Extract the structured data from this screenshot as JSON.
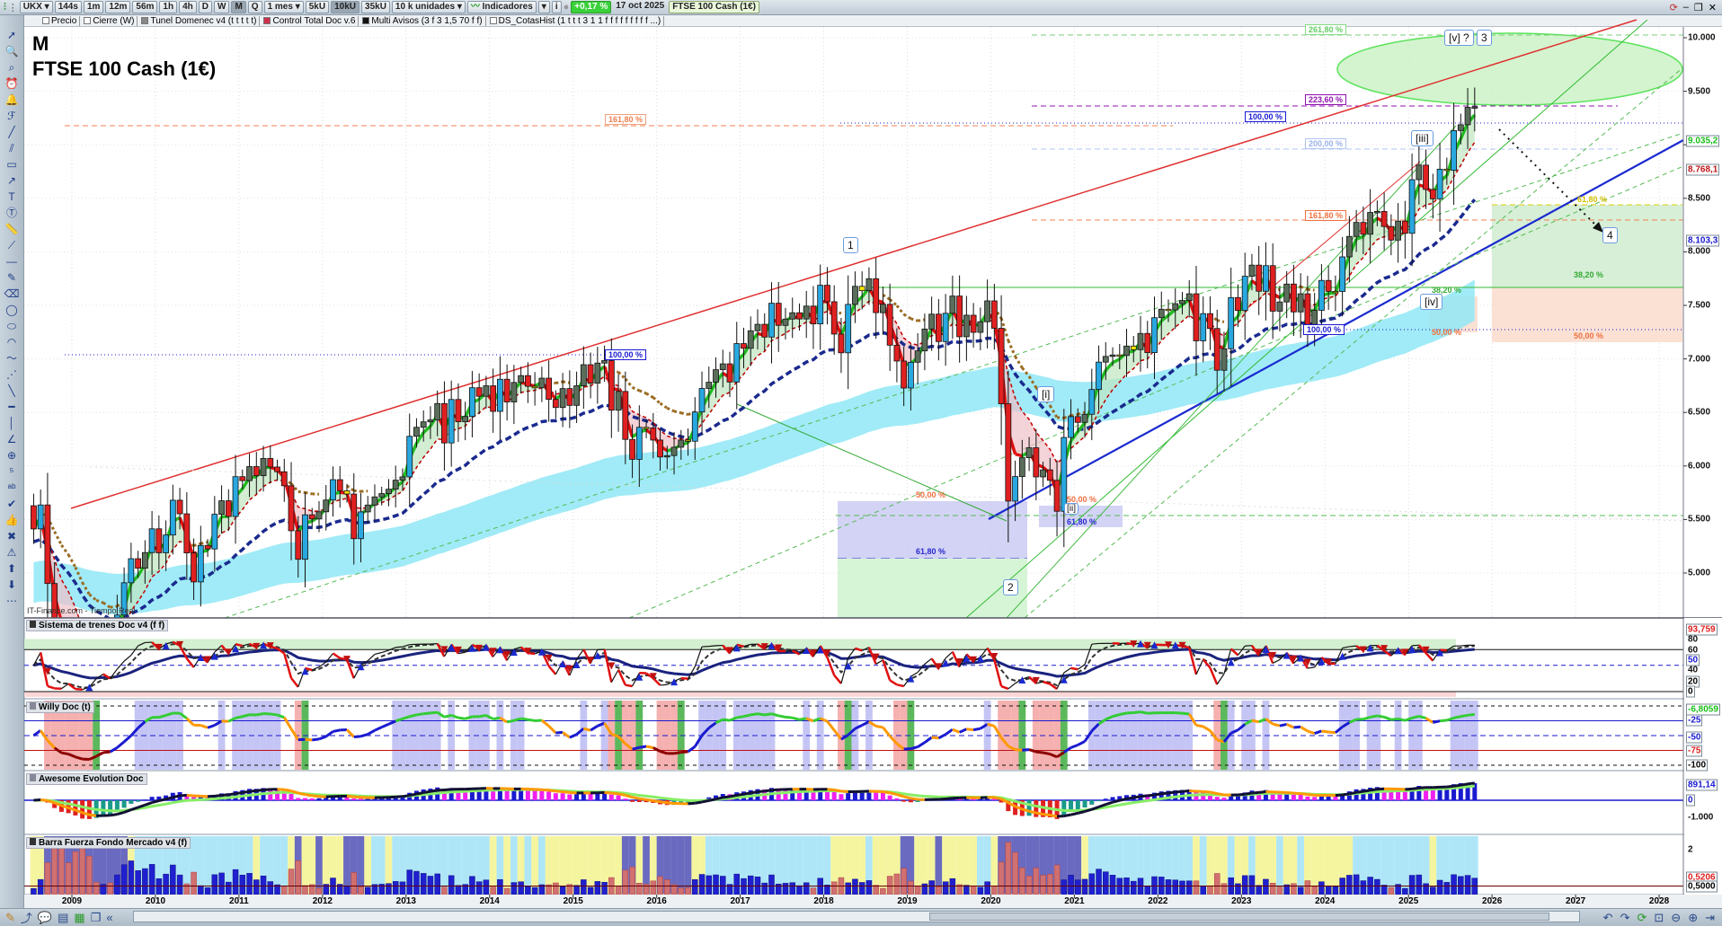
{
  "toolbar": {
    "symbol": "UKX",
    "intervals": [
      "144s",
      "1m",
      "12m",
      "56m",
      "1h",
      "4h",
      "D",
      "W",
      "M",
      "Q"
    ],
    "selected_interval": "M",
    "period": "1 mes",
    "units": [
      "5kU",
      "10kU",
      "35kU"
    ],
    "selected_units": "10kU",
    "units_select": "10 k unidades",
    "indicators": "Indicadores",
    "info": "i",
    "change": "+0,17 %",
    "date": "17 oct 2025",
    "instrument": "FTSE 100 Cash (1€)"
  },
  "legend": [
    "Precio",
    "Cierre (W)",
    "Tunel Domenec v4 (t t t t t)",
    "Control Total Doc v.6",
    "Multi Avisos (3 f 3 1,5 70 f f)",
    "DS_CotasHist (1 t t t 3 1 1 f f f f f f f f f ...)"
  ],
  "header": {
    "timeframe": "M",
    "title": "FTSE 100 Cash (1€)",
    "source": "IT-Finance.com - Tiempo Real"
  },
  "price_axis": {
    "ticks": [
      5000,
      5500,
      6000,
      6500,
      7000,
      7500,
      8000,
      8500,
      9000,
      9500,
      10000
    ],
    "tick_labels": [
      "5.000",
      "5.500",
      "6.000",
      "6.500",
      "7.000",
      "7.500",
      "8.000",
      "8.500",
      "9.000",
      "9.500",
      "10.000"
    ],
    "markers": [
      {
        "label": "9.035,2",
        "value": 9035.2,
        "color": "#19c019"
      },
      {
        "label": "8.768,1",
        "value": 8768.1,
        "color": "#c01818"
      },
      {
        "label": "8.103,3",
        "value": 8103.3,
        "color": "#1a1ad0"
      }
    ]
  },
  "fib_labels": [
    "261,80 %",
    "223,60 %",
    "100,00 %",
    "200,00 %",
    "161,80 %",
    "161,80 %",
    "100,00 %",
    "50,00 %",
    "61,80 %",
    "50,00 %",
    "61,80 %",
    "38,20 %",
    "50,00 %",
    "100,00 %",
    "61,80 %",
    "38,20 %",
    "50,00 %"
  ],
  "wave_labels": [
    "1",
    "2",
    "[i]",
    "[ii]",
    "[iii]",
    "[iv]",
    "[v] ?",
    "3",
    "4"
  ],
  "panels": [
    {
      "title": "Sistema de trenes Doc v4 (f f)",
      "axis": [
        "80",
        "60",
        "40",
        "20",
        "0"
      ],
      "markers": [
        "93,759",
        "50"
      ]
    },
    {
      "title": "Willy Doc (t)",
      "axis": [
        "-100"
      ],
      "markers": [
        "-6,8059",
        "-25",
        "-50",
        "-75"
      ]
    },
    {
      "title": "Awesome Evolution Doc",
      "axis": [
        "-1.000"
      ],
      "markers": [
        "891,14",
        "0"
      ]
    },
    {
      "title": "Barra Fuerza Fondo Mercado v4 (f)",
      "axis": [
        "2"
      ],
      "markers": [
        "0,5206",
        "0,5000"
      ]
    }
  ],
  "colors": {
    "up": "#5b6e5b",
    "strong_up": "#29a8e0",
    "down": "#e02020",
    "doji": "#f5e400",
    "fast_ma": "#22bb22",
    "slow_ma": "#c00000",
    "trend_ma": "#1a2a8e",
    "band": "#8fe8f6"
  },
  "chart_data": {
    "type": "candlestick",
    "title": "FTSE 100 Cash (1€)",
    "timeframe": "monthly",
    "start": "2008-07",
    "closes": [
      5412,
      5636,
      4902,
      4377,
      4288,
      4434,
      4150,
      3830,
      3926,
      4244,
      4418,
      4249,
      4608,
      4909,
      5134,
      5045,
      5191,
      5413,
      5189,
      5355,
      5680,
      5553,
      5188,
      4917,
      5258,
      5225,
      5549,
      5675,
      5528,
      5900,
      5863,
      5994,
      5909,
      6070,
      5990,
      5946,
      5815,
      5395,
      5128,
      5544,
      5505,
      5572,
      5682,
      5872,
      5768,
      5738,
      5321,
      5571,
      5635,
      5711,
      5742,
      5783,
      5867,
      5898,
      6277,
      6361,
      6412,
      6430,
      6583,
      6215,
      6621,
      6413,
      6462,
      6731,
      6651,
      6749,
      6510,
      6810,
      6598,
      6780,
      6844,
      6744,
      6730,
      6820,
      6622,
      6546,
      6723,
      6566,
      6749,
      6946,
      6773,
      6961,
      6984,
      6521,
      6696,
      6248,
      6062,
      6361,
      6356,
      6242,
      6084,
      6097,
      6175,
      6242,
      6231,
      6504,
      6724,
      6782,
      6899,
      6954,
      6784,
      7143,
      7099,
      7263,
      7323,
      7204,
      7520,
      7313,
      7372,
      7431,
      7373,
      7493,
      7327,
      7688,
      7534,
      7232,
      7057,
      7509,
      7678,
      7637,
      7749,
      7432,
      7510,
      7128,
      6980,
      6728,
      6969,
      7075,
      7279,
      7418,
      7162,
      7426,
      7587,
      7207,
      7408,
      7248,
      7347,
      7542,
      7286,
      6581,
      5672,
      5901,
      6077,
      6170,
      5898,
      5964,
      5866,
      5577,
      6266,
      6461,
      6407,
      6483,
      6714,
      6970,
      7023,
      7037,
      7032,
      7120,
      7086,
      7238,
      7059,
      7385,
      7464,
      7458,
      7516,
      7545,
      7608,
      7169,
      7423,
      7284,
      6894,
      7095,
      7573,
      7452,
      7772,
      7876,
      7632,
      7871,
      7446,
      7532,
      7699,
      7439,
      7608,
      7322,
      7454,
      7733,
      7631,
      7630,
      7953,
      8144,
      8275,
      8164,
      8368,
      8377,
      8237,
      8110,
      8287,
      8173,
      8674,
      8810,
      8583,
      8495,
      8772,
      8761,
      9133,
      9187,
      9350,
      9354
    ],
    "x_ticks": [
      "2009",
      "2010",
      "2011",
      "2012",
      "2013",
      "2014",
      "2015",
      "2016",
      "2017",
      "2018",
      "2019",
      "2020",
      "2021",
      "2022",
      "2023",
      "2024",
      "2025",
      "2026",
      "2027",
      "2028"
    ],
    "ylim": [
      4580,
      10100
    ],
    "fib_levels": {
      "261.8": 10010,
      "223.6": 9360,
      "200.0": 8960,
      "161.8": 8290,
      "100.0": 9195
    }
  }
}
